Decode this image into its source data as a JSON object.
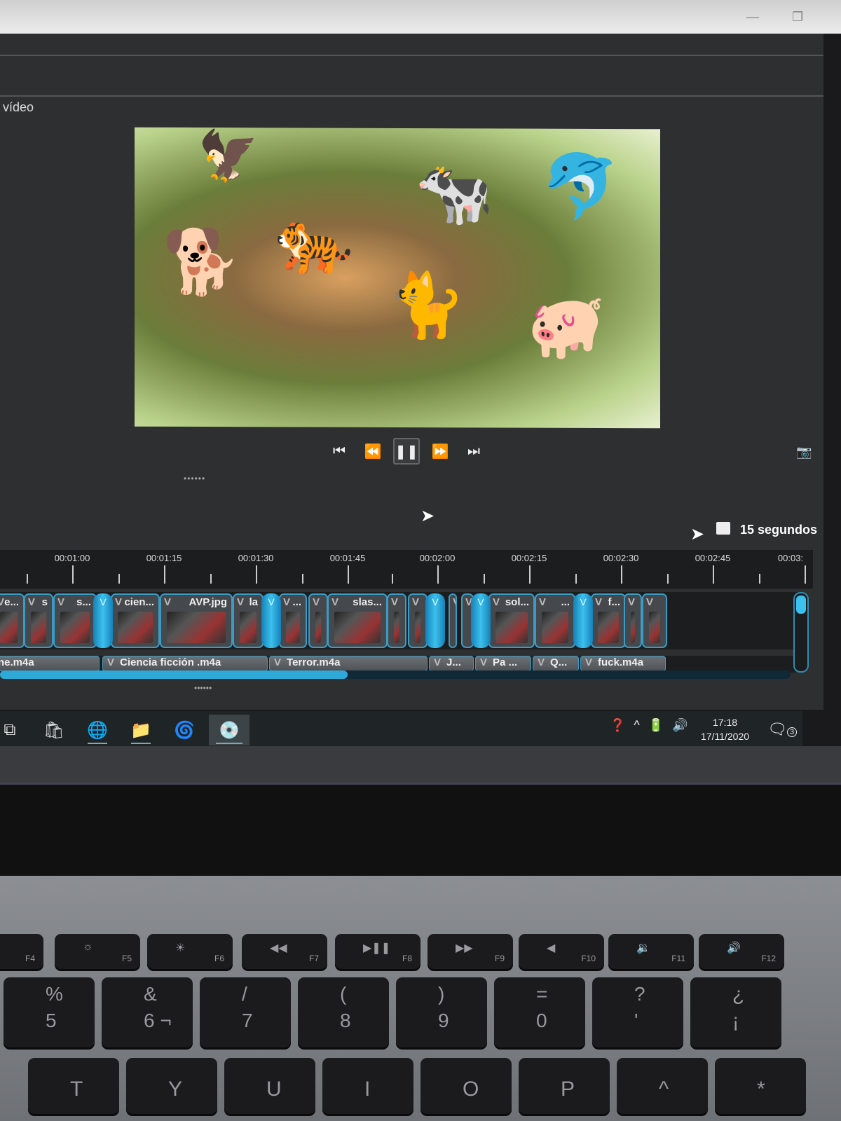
{
  "window": {
    "minimize_icon": "minimize-icon",
    "restore_icon": "restore-icon"
  },
  "panel": {
    "title": "vídeo"
  },
  "player": {
    "buttons": [
      "skip-start",
      "rewind",
      "pause",
      "fast-forward",
      "skip-end"
    ],
    "snapshot_icon": "camera-icon"
  },
  "zoom": {
    "label": "15 segundos"
  },
  "ruler": {
    "labels": [
      "00:01:00",
      "00:01:15",
      "00:01:30",
      "00:01:45",
      "00:02:00",
      "00:02:15",
      "00:02:30",
      "00:02:45",
      "00:03:"
    ]
  },
  "video_clips": [
    "e...",
    "s",
    "s...",
    "cien...",
    "AVP.jpg",
    "la",
    "...",
    "slas...",
    "sol...",
    "...",
    "f..."
  ],
  "audio_clips": [
    "ne.m4a",
    "Ciencia ficción .m4a",
    "Terror.m4a",
    "J...",
    "Pa ...",
    "Q...",
    "fuck.m4a"
  ],
  "playback_progress_percent": 44,
  "taskbar": {
    "time": "17:18",
    "date": "17/11/2020",
    "notifications": "3"
  },
  "keyboard": {
    "fkeys": [
      "F4",
      "F5",
      "F6",
      "F7",
      "F8",
      "F9",
      "F10",
      "F11",
      "F12"
    ],
    "numrow": [
      [
        "%",
        "5"
      ],
      [
        "&",
        "6 ¬"
      ],
      [
        "/",
        "7"
      ],
      [
        "(",
        "8"
      ],
      [
        ")",
        "9"
      ],
      [
        "=",
        "0"
      ],
      [
        "?",
        "'"
      ],
      [
        "¿",
        "¡"
      ]
    ],
    "letters": [
      "T",
      "Y",
      "U",
      "I",
      "O",
      "P",
      "^",
      "*"
    ]
  }
}
